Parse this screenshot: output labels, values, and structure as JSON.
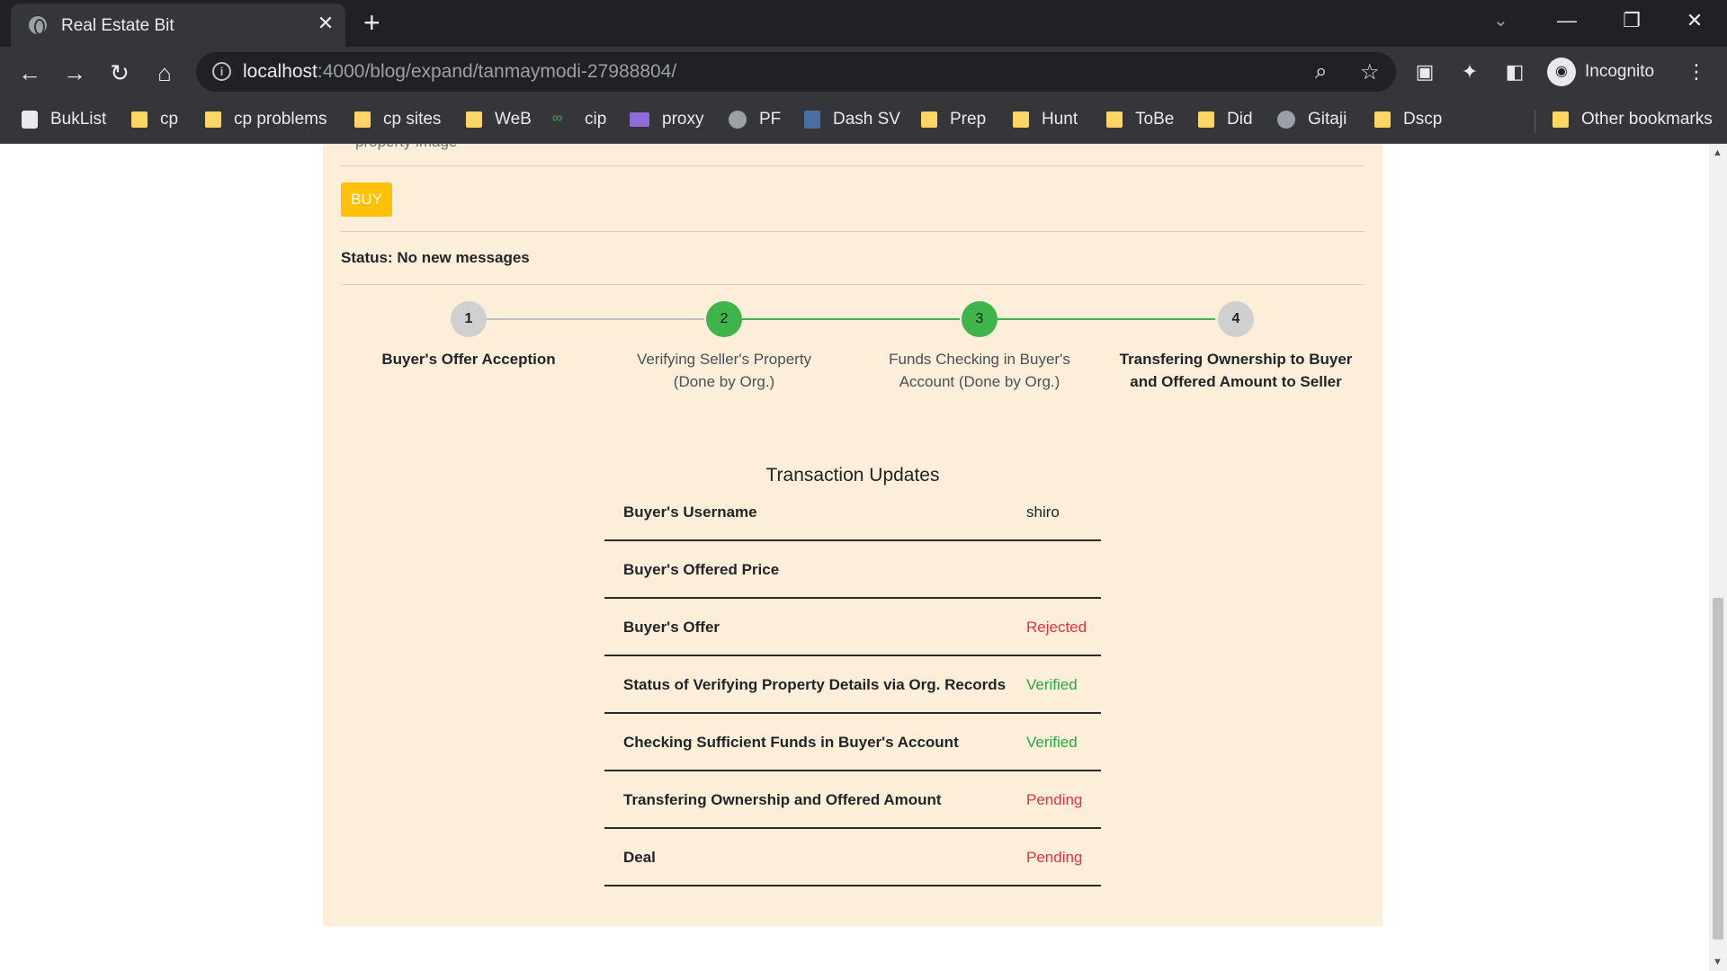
{
  "browser": {
    "tab_title": "Real Estate Bit",
    "url_host": "localhost",
    "url_path": ":4000/blog/expand/tanmaymodi-27988804/",
    "profile_label": "Incognito",
    "bookmarks": [
      {
        "label": "BukList",
        "icon": "buklist-icon"
      },
      {
        "label": "cp",
        "icon": "folder-icon"
      },
      {
        "label": "cp problems",
        "icon": "folder-icon"
      },
      {
        "label": "cp sites",
        "icon": "folder-icon"
      },
      {
        "label": "WeB",
        "icon": "folder-icon"
      },
      {
        "label": "cip",
        "icon": "cip-icon"
      },
      {
        "label": "proxy",
        "icon": "proxy-icon"
      },
      {
        "label": "PF",
        "icon": "globe-icon"
      },
      {
        "label": "Dash SV",
        "icon": "chart-icon"
      },
      {
        "label": "Prep",
        "icon": "folder-icon"
      },
      {
        "label": "Hunt",
        "icon": "folder-icon"
      },
      {
        "label": "ToBe",
        "icon": "folder-icon"
      },
      {
        "label": "Did",
        "icon": "folder-icon"
      },
      {
        "label": "Gitaji",
        "icon": "globe-icon"
      },
      {
        "label": "Dscp",
        "icon": "folder-icon"
      }
    ],
    "other_bookmarks": "Other bookmarks"
  },
  "page": {
    "cut_text": "property image",
    "buy_label": "BUY",
    "status_text": "Status: No new messages",
    "steps": [
      {
        "number": "1",
        "label": "Buyer's Offer Acception",
        "state": "pending"
      },
      {
        "number": "2",
        "label": "Verifying Seller's Property (Done by Org.)",
        "state": "done"
      },
      {
        "number": "3",
        "label": "Funds Checking in Buyer's Account (Done by Org.)",
        "state": "done"
      },
      {
        "number": "4",
        "label": "Transfering Ownership to Buyer and Offered Amount to Seller",
        "state": "pending"
      }
    ],
    "transaction_title": "Transaction Updates",
    "transactions": [
      {
        "label": "Buyer's Username",
        "value": "shiro",
        "tone": "plain"
      },
      {
        "label": "Buyer's Offered Price",
        "value": "",
        "tone": "plain"
      },
      {
        "label": "Buyer's Offer",
        "value": "Rejected",
        "tone": "red"
      },
      {
        "label": "Status of Verifying Property Details via Org. Records",
        "value": "Verified",
        "tone": "green"
      },
      {
        "label": "Checking Sufficient Funds in Buyer's Account",
        "value": "Verified",
        "tone": "green"
      },
      {
        "label": "Transfering Ownership and Offered Amount",
        "value": "Pending",
        "tone": "red"
      },
      {
        "label": "Deal",
        "value": "Pending",
        "tone": "red"
      }
    ]
  },
  "colors": {
    "card_bg": "#fdeed9",
    "buy_button": "#ffc107",
    "step_done": "#3fb44a",
    "step_pending": "#d0d0d0",
    "status_red": "#dc3545",
    "status_green": "#28a745"
  }
}
